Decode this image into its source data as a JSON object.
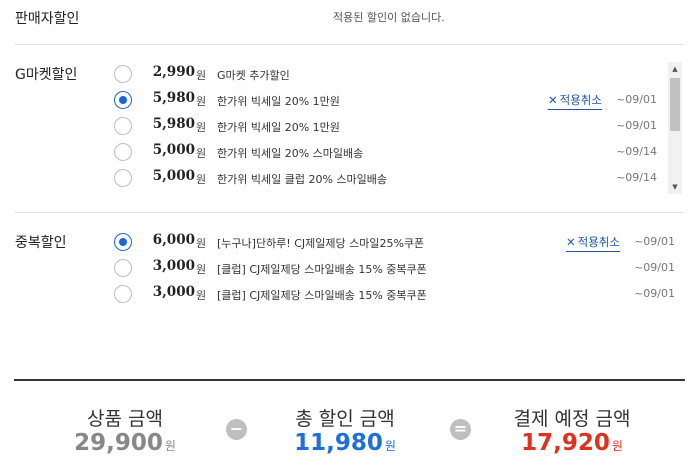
{
  "seller": {
    "title": "판매자할인",
    "none_msg": "적용된 할인이 없습니다."
  },
  "gmarket": {
    "title": "G마켓할인",
    "items": [
      {
        "amount": "2,990",
        "unit": "원",
        "name": "G마켓 추가할인",
        "date": "",
        "selected": false
      },
      {
        "amount": "5,980",
        "unit": "원",
        "name": "한가위 빅세일 20% 1만원",
        "date": "~09/01",
        "selected": true,
        "cancel": "적용취소"
      },
      {
        "amount": "5,980",
        "unit": "원",
        "name": "한가위 빅세일 20% 1만원",
        "date": "~09/01",
        "selected": false
      },
      {
        "amount": "5,000",
        "unit": "원",
        "name": "한가위 빅세일 20% 스마일배송",
        "date": "~09/14",
        "selected": false
      },
      {
        "amount": "5,000",
        "unit": "원",
        "name": "한가위 빅세일 클럽 20% 스마일배송",
        "date": "~09/14",
        "selected": false
      }
    ]
  },
  "duplicate": {
    "title": "중복할인",
    "items": [
      {
        "amount": "6,000",
        "unit": "원",
        "name": "[누구나]단하루! CJ제일제당 스마일25%쿠폰",
        "date": "~09/01",
        "selected": true,
        "cancel": "적용취소"
      },
      {
        "amount": "3,000",
        "unit": "원",
        "name": "[클럽] CJ제일제당 스마일배송 15% 중복쿠폰",
        "date": "~09/01",
        "selected": false
      },
      {
        "amount": "3,000",
        "unit": "원",
        "name": "[클럽] CJ제일제당 스마일배송 15% 중복쿠폰",
        "date": "~09/01",
        "selected": false
      }
    ]
  },
  "summary": {
    "product": {
      "label": "상품 금액",
      "value": "29,900",
      "unit": "원",
      "color": "#888888"
    },
    "minus": "−",
    "discount": {
      "label": "총 할인 금액",
      "value": "11,980",
      "unit": "원",
      "color": "#1e6fd9"
    },
    "equals": "=",
    "payment": {
      "label": "결제 예정 금액",
      "value": "17,920",
      "unit": "원",
      "color": "#e0301e"
    }
  },
  "icons": {
    "cancel": "x-icon",
    "scroll_up": "triangle-up-icon",
    "scroll_down": "triangle-down-icon"
  }
}
